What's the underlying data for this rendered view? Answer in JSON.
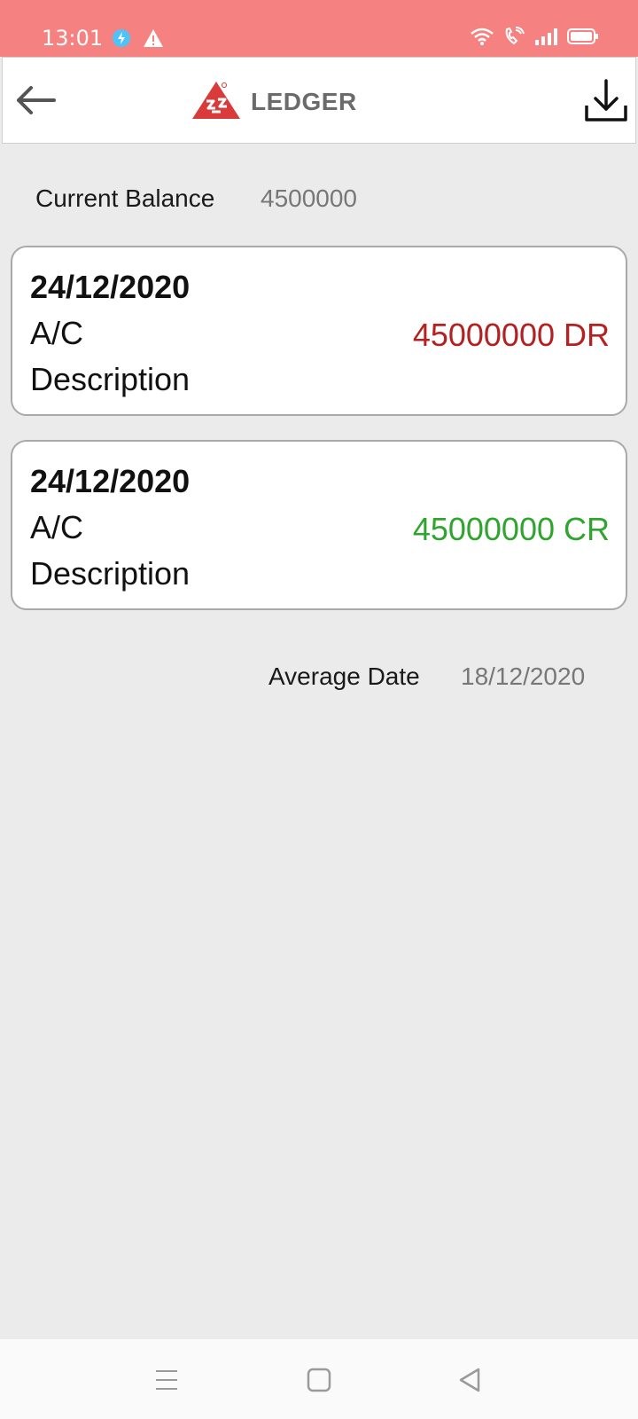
{
  "status_bar": {
    "time": "13:01",
    "icons": [
      "power-saving-icon",
      "alert-icon",
      "wifi-icon",
      "wifi-call-icon",
      "signal-icon",
      "battery-icon"
    ]
  },
  "header": {
    "title": "LEDGER",
    "logo_text": "SS",
    "accent": "#d93a3a",
    "status_bar_color": "#f58181"
  },
  "balance": {
    "label": "Current Balance",
    "value": "4500000"
  },
  "transactions": [
    {
      "date": "24/12/2020",
      "account": "A/C",
      "description": "Description",
      "amount": "45000000 DR",
      "color": "#b52020"
    },
    {
      "date": "24/12/2020",
      "account": "A/C",
      "description": "Description",
      "amount": "45000000 CR",
      "color": "#2fa52f"
    }
  ],
  "average": {
    "label": "Average Date",
    "value": "18/12/2020"
  },
  "nav": {
    "icons": [
      "menu-icon",
      "home-icon",
      "back-nav-icon"
    ]
  }
}
